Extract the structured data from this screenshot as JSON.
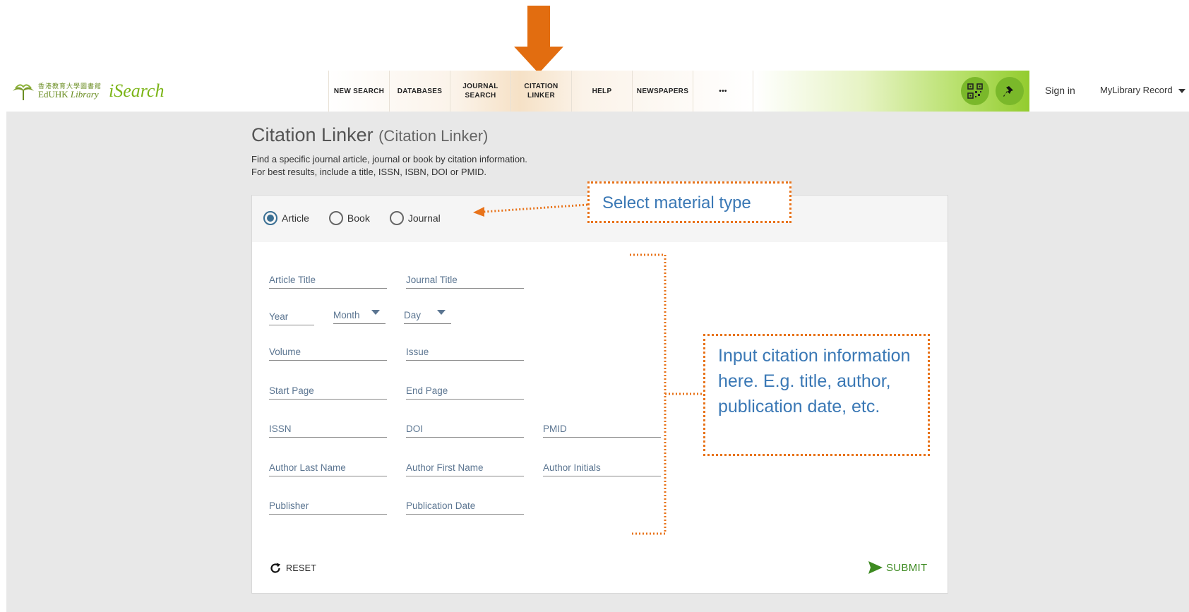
{
  "header": {
    "logo_cn": "香港教育大學圖書館",
    "logo_en_a": "EdUHK",
    "logo_en_b": "Library",
    "logo_search": "iSearch",
    "nav": [
      {
        "label": "NEW SEARCH"
      },
      {
        "label": "DATABASES"
      },
      {
        "label": "JOURNAL\nSEARCH"
      },
      {
        "label": "CITATION\nLINKER"
      },
      {
        "label": "HELP"
      },
      {
        "label": "NEWSPAPERS"
      },
      {
        "label": "•••"
      }
    ],
    "qr_icon": "qr-code-icon",
    "pin_icon": "pin-icon",
    "signin": "Sign in",
    "mylibrary": "MyLibrary Record"
  },
  "page": {
    "title": "Citation Linker",
    "title_sub": "(Citation Linker)",
    "desc_line1": "Find a specific journal article, journal or book by citation information.",
    "desc_line2": "For best results, include a title, ISSN, ISBN, DOI or PMID."
  },
  "form": {
    "material_types": [
      {
        "label": "Article",
        "selected": true
      },
      {
        "label": "Book",
        "selected": false
      },
      {
        "label": "Journal",
        "selected": false
      }
    ],
    "fields": {
      "article_title": "Article Title",
      "journal_title": "Journal Title",
      "year": "Year",
      "month": "Month",
      "day": "Day",
      "volume": "Volume",
      "issue": "Issue",
      "start_page": "Start Page",
      "end_page": "End Page",
      "issn": "ISSN",
      "doi": "DOI",
      "pmid": "PMID",
      "author_last": "Author Last Name",
      "author_first": "Author First Name",
      "author_initials": "Author Initials",
      "publisher": "Publisher",
      "publication_date": "Publication Date"
    },
    "reset_label": "RESET",
    "submit_label": "SUBMIT"
  },
  "annotations": {
    "material_type": "Select material type",
    "citation_info": "Input citation information here. E.g. title, author, publication date, etc."
  },
  "colors": {
    "annotation_orange": "#e8731a",
    "annotation_text": "#3a78b5",
    "accent_green": "#7ab82a",
    "submit_green": "#3d8a21"
  }
}
